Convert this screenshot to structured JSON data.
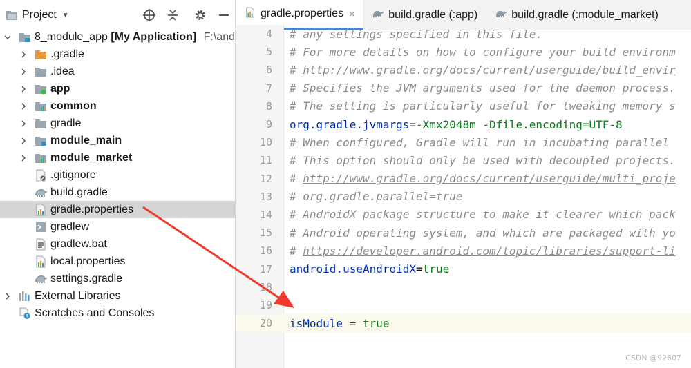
{
  "project_panel": {
    "title": "Project",
    "tree": [
      {
        "label": "8_module_app",
        "bold_suffix": "[My Application]",
        "path": "F:\\and",
        "icon": "module-folder-icon"
      },
      {
        "label": ".gradle",
        "icon": "orange-folder-icon"
      },
      {
        "label": ".idea",
        "icon": "folder-icon"
      },
      {
        "label": "app",
        "icon": "app-module-icon"
      },
      {
        "label": "common",
        "icon": "library-module-icon"
      },
      {
        "label": "gradle",
        "icon": "folder-icon"
      },
      {
        "label": "module_main",
        "icon": "module-folder-icon"
      },
      {
        "label": "module_market",
        "icon": "library-module-icon"
      },
      {
        "label": ".gitignore",
        "icon": "gitignore-file-icon"
      },
      {
        "label": "build.gradle",
        "icon": "gradle-file-icon"
      },
      {
        "label": "gradle.properties",
        "icon": "properties-file-icon"
      },
      {
        "label": "gradlew",
        "icon": "shell-file-icon"
      },
      {
        "label": "gradlew.bat",
        "icon": "bat-file-icon"
      },
      {
        "label": "local.properties",
        "icon": "properties-file-icon"
      },
      {
        "label": "settings.gradle",
        "icon": "gradle-file-icon"
      },
      {
        "label": "External Libraries",
        "icon": "libraries-icon"
      },
      {
        "label": "Scratches and Consoles",
        "icon": "scratches-icon"
      }
    ]
  },
  "editor": {
    "tabs": [
      {
        "label": "gradle.properties",
        "active": true,
        "closable": "×"
      },
      {
        "label": "build.gradle (:app)"
      },
      {
        "label": "build.gradle (:module_market)"
      }
    ],
    "lines": [
      {
        "num": "4",
        "text": "# any settings specified in this file."
      },
      {
        "num": "5",
        "text": "# For more details on how to configure your build environm"
      },
      {
        "num": "6",
        "hash": "# ",
        "link": "http://www.gradle.org/docs/current/userguide/build_envir"
      },
      {
        "num": "7",
        "text": "# Specifies the JVM arguments used for the daemon process."
      },
      {
        "num": "8",
        "text": "# The setting is particularly useful for tweaking memory s"
      },
      {
        "num": "9",
        "key": "org.gradle.jvmargs",
        "eq": "=",
        "value": "-Xmx2048m -Dfile.encoding=UTF-8"
      },
      {
        "num": "10",
        "text": "# When configured, Gradle will run in incubating parallel "
      },
      {
        "num": "11",
        "text": "# This option should only be used with decoupled projects."
      },
      {
        "num": "12",
        "hash": "# ",
        "link": "http://www.gradle.org/docs/current/userguide/multi_proje"
      },
      {
        "num": "13",
        "text": "# org.gradle.parallel=true"
      },
      {
        "num": "14",
        "text": "# AndroidX package structure to make it clearer which pack"
      },
      {
        "num": "15",
        "text": "# Android operating system, and which are packaged with yo"
      },
      {
        "num": "16",
        "hash": "# ",
        "link": "https://developer.android.com/topic/libraries/support-li"
      },
      {
        "num": "17",
        "key": "android.useAndroidX",
        "eq": "=",
        "value": "true"
      },
      {
        "num": "18",
        "text": ""
      },
      {
        "num": "19",
        "text": ""
      },
      {
        "num": "20",
        "key": "isModule",
        "eq": " = ",
        "value": "true",
        "current": true
      }
    ]
  },
  "watermark": "CSDN @92607",
  "colors": {
    "selection": "#d5d5d5",
    "comment": "#8c8c8c",
    "key": "#0033b3",
    "value": "#067d17",
    "arrow": "#f03a2e",
    "active_tab_underline": "#4a86c8"
  }
}
